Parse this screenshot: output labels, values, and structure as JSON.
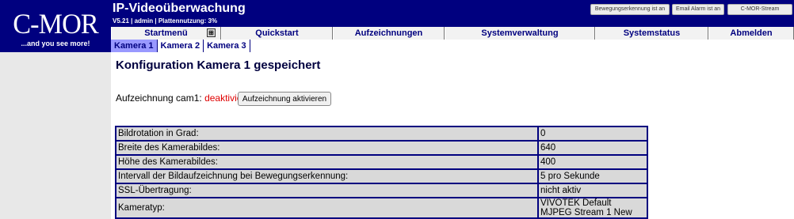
{
  "logo": {
    "brand": "C-MOR",
    "tagline": "...and you see more!"
  },
  "header": {
    "title": "IP-Videoüberwachung",
    "status": "V5.21 | admin | Plattennutzung: 3%",
    "buttons": {
      "motion": "Bewegungserkennung ist an",
      "email": "Email Alarm ist an",
      "stream": "C-MOR-Stream"
    }
  },
  "menu": {
    "start": "Startmenü",
    "quickstart": "Quickstart",
    "recordings": "Aufzeichnungen",
    "system": "Systemverwaltung",
    "status": "Systemstatus",
    "logout": "Abmelden"
  },
  "tabs": [
    "Kamera 1",
    "Kamera 2",
    "Kamera 3"
  ],
  "main": {
    "title": "Konfiguration Kamera 1 gespeichert",
    "recording_label": "Aufzeichnung cam1:",
    "recording_status": "deaktiviert",
    "activate_button": "Aufzeichnung aktivieren"
  },
  "config_rows": [
    {
      "label": "Bildrotation in Grad:",
      "value": "0"
    },
    {
      "label": "Breite des Kamerabildes:",
      "value": "640"
    },
    {
      "label": "Höhe des Kamerabildes:",
      "value": "400"
    },
    {
      "label": "Intervall der Bildaufzeichnung bei Bewegungserkennung:",
      "value": "5 pro Sekunde"
    },
    {
      "label": "SSL-Übertragung:",
      "value": "nicht aktiv"
    },
    {
      "label": "Kameratyp:",
      "value": "VIVOTEK Default MJPEG Stream 1 New"
    }
  ],
  "colors": {
    "brand_blue": "#00007f",
    "active_tab": "#9999ff",
    "warning_red": "#e00000"
  }
}
